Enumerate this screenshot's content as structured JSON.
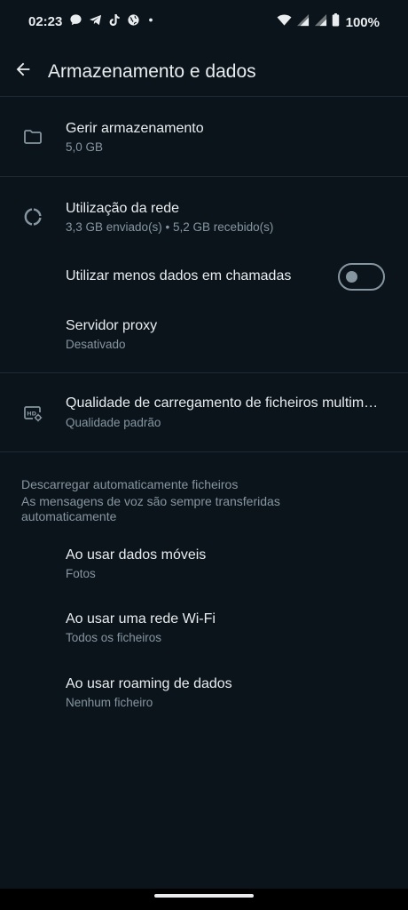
{
  "status_bar": {
    "time": "02:23",
    "battery": "100%",
    "left_icons": [
      "chat-bubble-icon",
      "telegram-icon",
      "tiktok-icon",
      "globe-icon",
      "dot-icon"
    ],
    "right_icons": [
      "wifi-icon",
      "signal-icon",
      "signal-icon",
      "battery-icon"
    ]
  },
  "app_bar": {
    "title": "Armazenamento e dados",
    "back_icon": "arrow-left-icon"
  },
  "items": {
    "manage_storage": {
      "title": "Gerir armazenamento",
      "subtitle": "5,0 GB",
      "icon": "folder-icon"
    },
    "network_usage": {
      "title": "Utilização da rede",
      "subtitle": "3,3 GB enviado(s) • 5,2 GB recebido(s)",
      "icon": "data-usage-icon"
    },
    "less_data_calls": {
      "title": "Utilizar menos dados em chamadas",
      "enabled": false
    },
    "proxy": {
      "title": "Servidor proxy",
      "subtitle": "Desativado"
    },
    "media_quality": {
      "title": "Qualidade de carregamento de ficheiros multimédia",
      "subtitle": "Qualidade padrão",
      "icon": "hd-settings-icon"
    }
  },
  "auto_download": {
    "header": "Descarregar automaticamente ficheiros",
    "description": "As mensagens de voz são sempre transferidas automaticamente",
    "mobile": {
      "title": "Ao usar dados móveis",
      "subtitle": "Fotos"
    },
    "wifi": {
      "title": "Ao usar uma rede Wi-Fi",
      "subtitle": "Todos os ficheiros"
    },
    "roaming": {
      "title": "Ao usar roaming de dados",
      "subtitle": "Nenhum ficheiro"
    }
  },
  "colors": {
    "background": "#0b141b",
    "primary_text": "#e9edef",
    "secondary_text": "#8696a0",
    "divider": "#1d2a33"
  }
}
